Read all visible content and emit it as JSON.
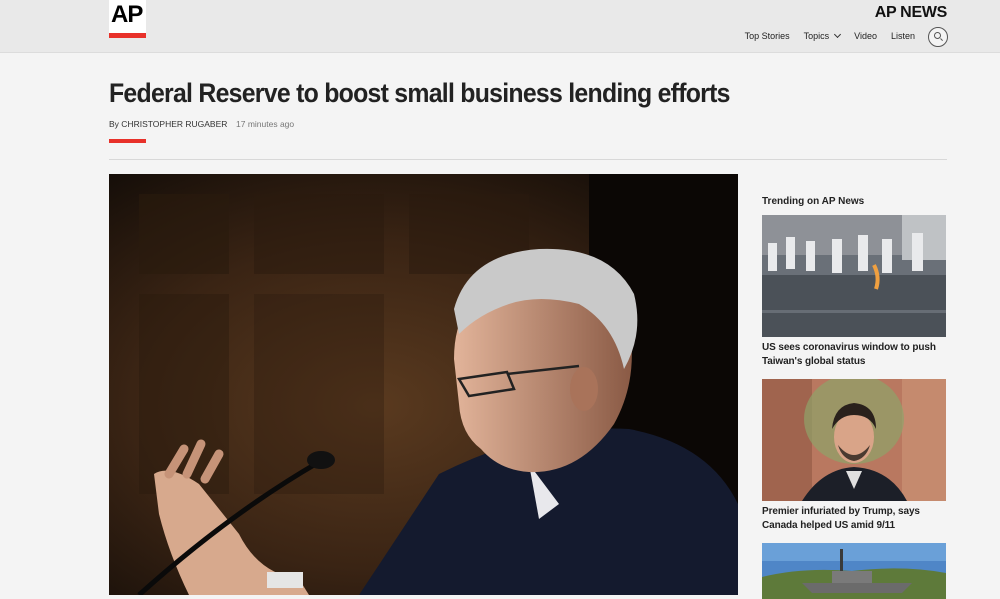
{
  "header": {
    "logo_text": "AP",
    "brand": "AP NEWS",
    "nav": [
      {
        "label": "Top Stories"
      },
      {
        "label": "Topics"
      },
      {
        "label": "Video"
      },
      {
        "label": "Listen"
      }
    ]
  },
  "article": {
    "headline": "Federal Reserve to boost small business lending efforts",
    "byline_prefix": "By",
    "author": "CHRISTOPHER RUGABER",
    "timestamp": "17 minutes ago"
  },
  "trending": {
    "title": "Trending on AP News",
    "items": [
      {
        "caption": "US sees coronavirus window to push Taiwan's global status"
      },
      {
        "caption": "Premier infuriated by Trump, says Canada helped US amid 9/11"
      }
    ]
  },
  "colors": {
    "accent": "#e8312a",
    "topbar": "#e9e9e9",
    "background": "#f4f4f4"
  }
}
